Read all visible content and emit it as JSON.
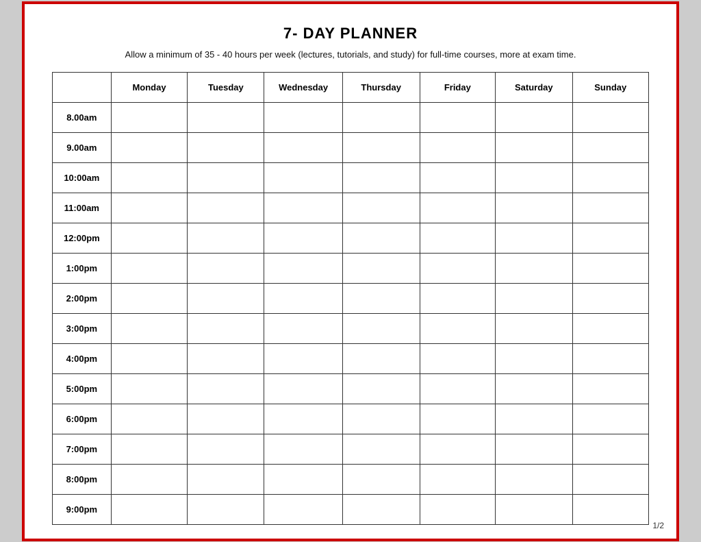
{
  "header": {
    "title": "7- DAY PLANNER",
    "subtitle": "Allow a minimum of 35 - 40 hours per week (lectures, tutorials, and study) for full-time courses, more at exam time."
  },
  "columns": {
    "time_header": "",
    "days": [
      "Monday",
      "Tuesday",
      "Wednesday",
      "Thursday",
      "Friday",
      "Saturday",
      "Sunday"
    ]
  },
  "time_slots": [
    "8.00am",
    "9.00am",
    "10:00am",
    "11:00am",
    "12:00pm",
    "1:00pm",
    "2:00pm",
    "3:00pm",
    "4:00pm",
    "5:00pm",
    "6:00pm",
    "7:00pm",
    "8:00pm",
    "9:00pm"
  ],
  "page_number": "1/2"
}
